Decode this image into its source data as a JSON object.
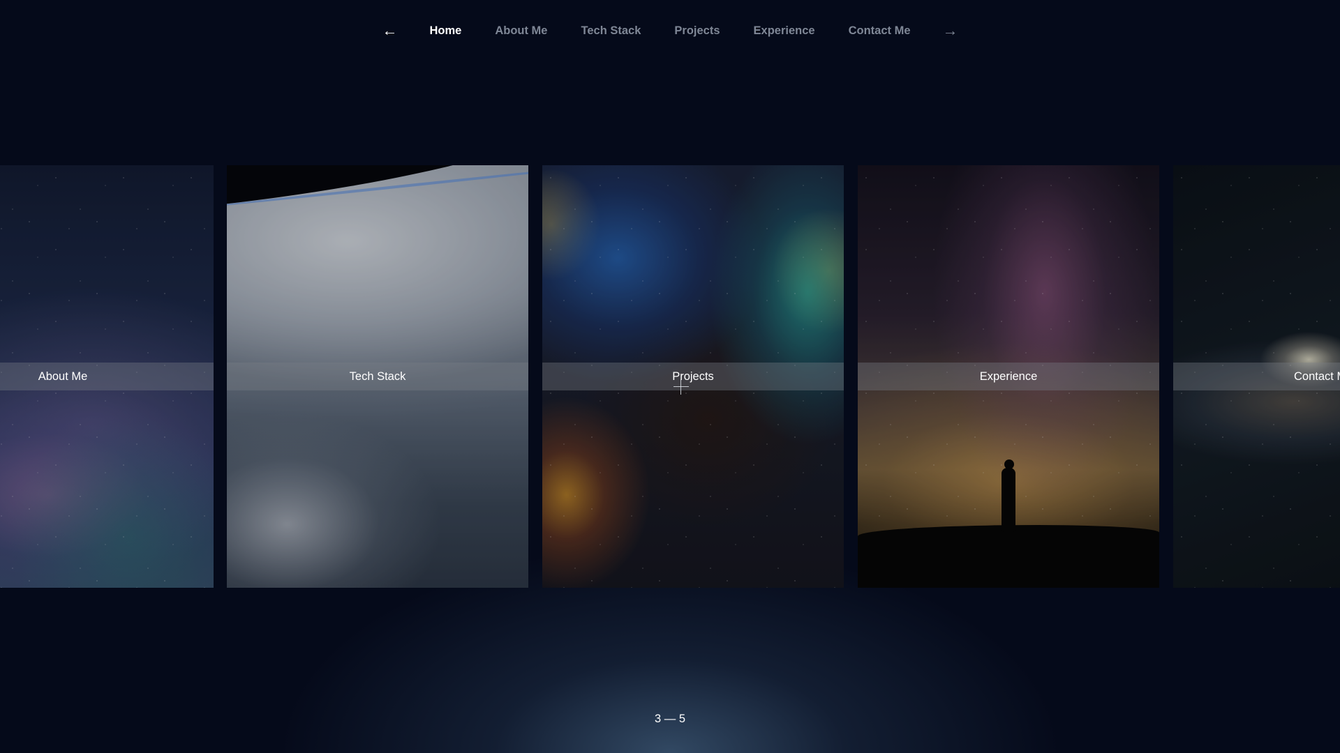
{
  "nav": {
    "prev_icon": "←",
    "next_icon": "→",
    "items": [
      {
        "label": "Home",
        "active": true
      },
      {
        "label": "About Me"
      },
      {
        "label": "Tech Stack"
      },
      {
        "label": "Projects"
      },
      {
        "label": "Experience"
      },
      {
        "label": "Contact Me"
      }
    ]
  },
  "slides": [
    {
      "label": "About Me",
      "image": "milky-way-sky"
    },
    {
      "label": "Tech Stack",
      "image": "earth-from-orbit"
    },
    {
      "label": "Projects",
      "image": "nebula"
    },
    {
      "label": "Experience",
      "image": "silhouette-under-milky-way"
    },
    {
      "label": "Contact Me",
      "image": "galaxy"
    }
  ],
  "pager": {
    "text": "3 — 5",
    "current": 3,
    "total": 5
  },
  "colors": {
    "background": "#050a1a",
    "nav_active": "#ffffff",
    "nav_inactive": "#7f8796"
  }
}
